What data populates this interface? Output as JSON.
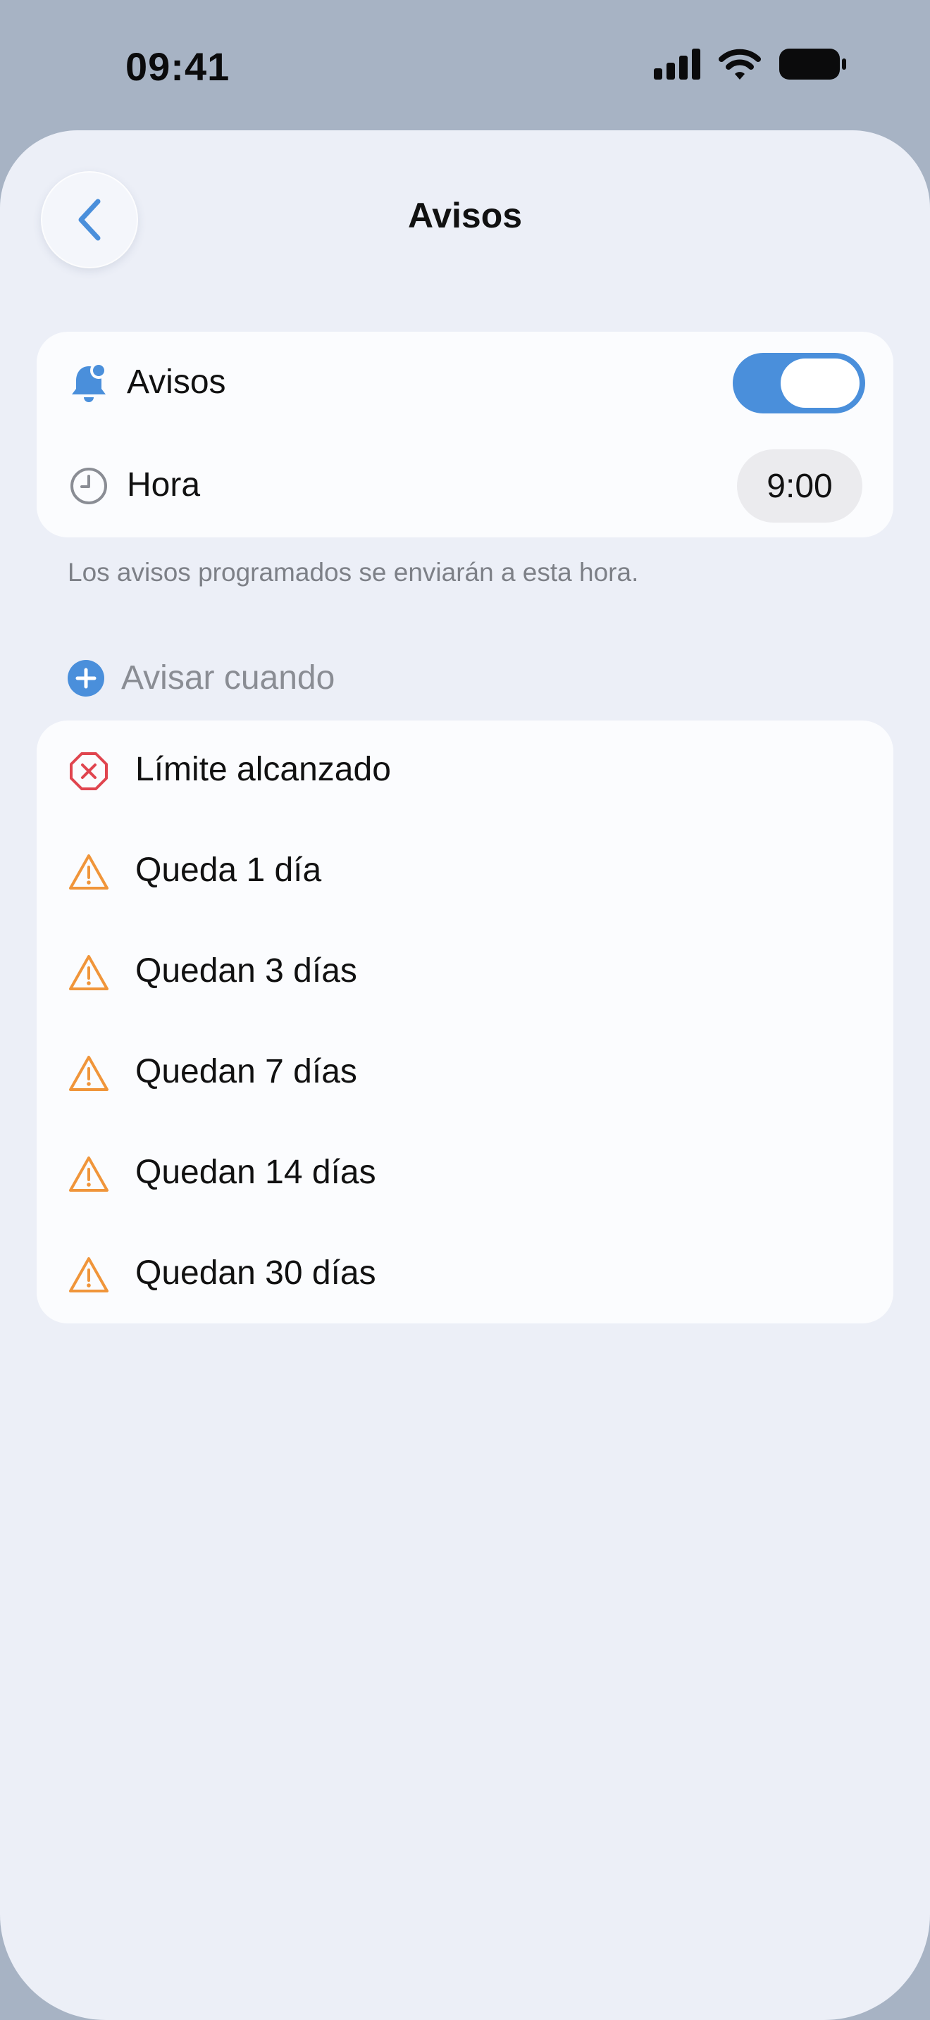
{
  "status_bar": {
    "time": "09:41"
  },
  "nav": {
    "title": "Avisos",
    "back_icon": "chevron-left-icon"
  },
  "settings": {
    "notifications": {
      "label": "Avisos",
      "icon": "bell-badge-icon",
      "enabled": true
    },
    "time": {
      "label": "Hora",
      "icon": "clock-icon",
      "value": "9:00"
    }
  },
  "footnote": "Los avisos programados se enviarán a esta hora.",
  "alerts_section": {
    "header": "Avisar cuando",
    "add_icon": "plus-circle-icon"
  },
  "alerts": [
    {
      "label": "Límite alcanzado",
      "icon": "x-octagon-icon"
    },
    {
      "label": "Queda 1 día",
      "icon": "warning-triangle-icon"
    },
    {
      "label": "Quedan 3 días",
      "icon": "warning-triangle-icon"
    },
    {
      "label": "Quedan 7 días",
      "icon": "warning-triangle-icon"
    },
    {
      "label": "Quedan 14 días",
      "icon": "warning-triangle-icon"
    },
    {
      "label": "Quedan 30 días",
      "icon": "warning-triangle-icon"
    }
  ],
  "colors": {
    "accent": "#4a8fdb",
    "danger": "#e0454f",
    "warning": "#f0953a",
    "sheet_background": "#eceff7",
    "card_background": "#fbfcfe"
  }
}
